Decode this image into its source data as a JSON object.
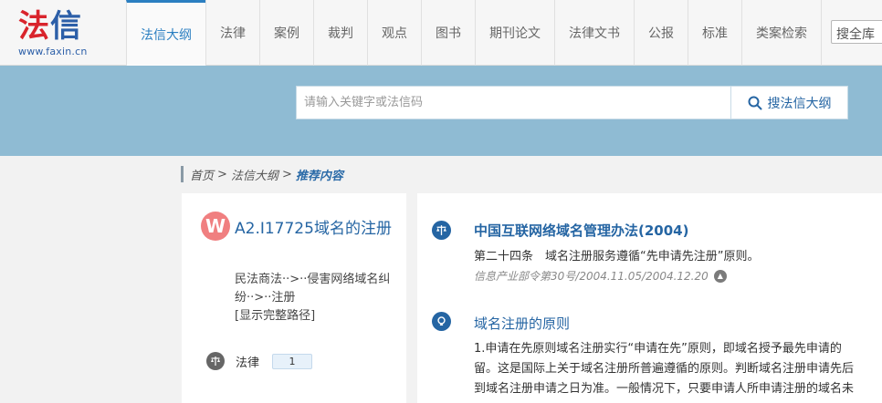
{
  "logo": {
    "mark_1": "法",
    "mark_2": "信",
    "url": "www.faxin.cn"
  },
  "nav": {
    "items": [
      {
        "label": "法信大纲",
        "active": true
      },
      {
        "label": "法律"
      },
      {
        "label": "案例"
      },
      {
        "label": "裁判"
      },
      {
        "label": "观点"
      },
      {
        "label": "图书"
      },
      {
        "label": "期刊论文"
      },
      {
        "label": "法律文书"
      },
      {
        "label": "公报"
      },
      {
        "label": "标准"
      },
      {
        "label": "类案检索"
      }
    ],
    "quick_search": "搜全库"
  },
  "search": {
    "placeholder": "请输入关键字或法信码",
    "button_label": "搜法信大纲",
    "icon": "search-icon"
  },
  "breadcrumb": {
    "home": "首页",
    "sep": ">",
    "outline": "法信大纲",
    "current": "推荐内容"
  },
  "outline": {
    "icon_letter": "W",
    "title": "A2.I17725域名的注册",
    "path_line1": "民法商法··>··侵害网络域名纠",
    "path_line2": "纷··>··注册",
    "show_full": "[显示完整路径]",
    "category_label": "法律",
    "category_count": "1"
  },
  "results": [
    {
      "title": "中国互联网络域名管理办法(2004)",
      "body": "第二十四条　域名注册服务遵循“先申请先注册”原则。",
      "meta": "信息产业部令第30号/2004.11.05/2004.12.20"
    },
    {
      "title": "域名注册的原则",
      "body_1": "1.申请在先原则域名注册实行“申请在先”原则，即域名授予最先申请的",
      "body_2": "留。这是国际上关于域名注册所普遍遵循的原则。判断域名注册申请先后",
      "body_3": "到域名注册申请之日为准。一般情况下，只要申请人所申请注册的域名未"
    }
  ],
  "colors": {
    "accent": "#2565a3",
    "banner": "#8fbbd3",
    "logo_red": "#d9242c",
    "outline_icon": "#f07f80"
  }
}
